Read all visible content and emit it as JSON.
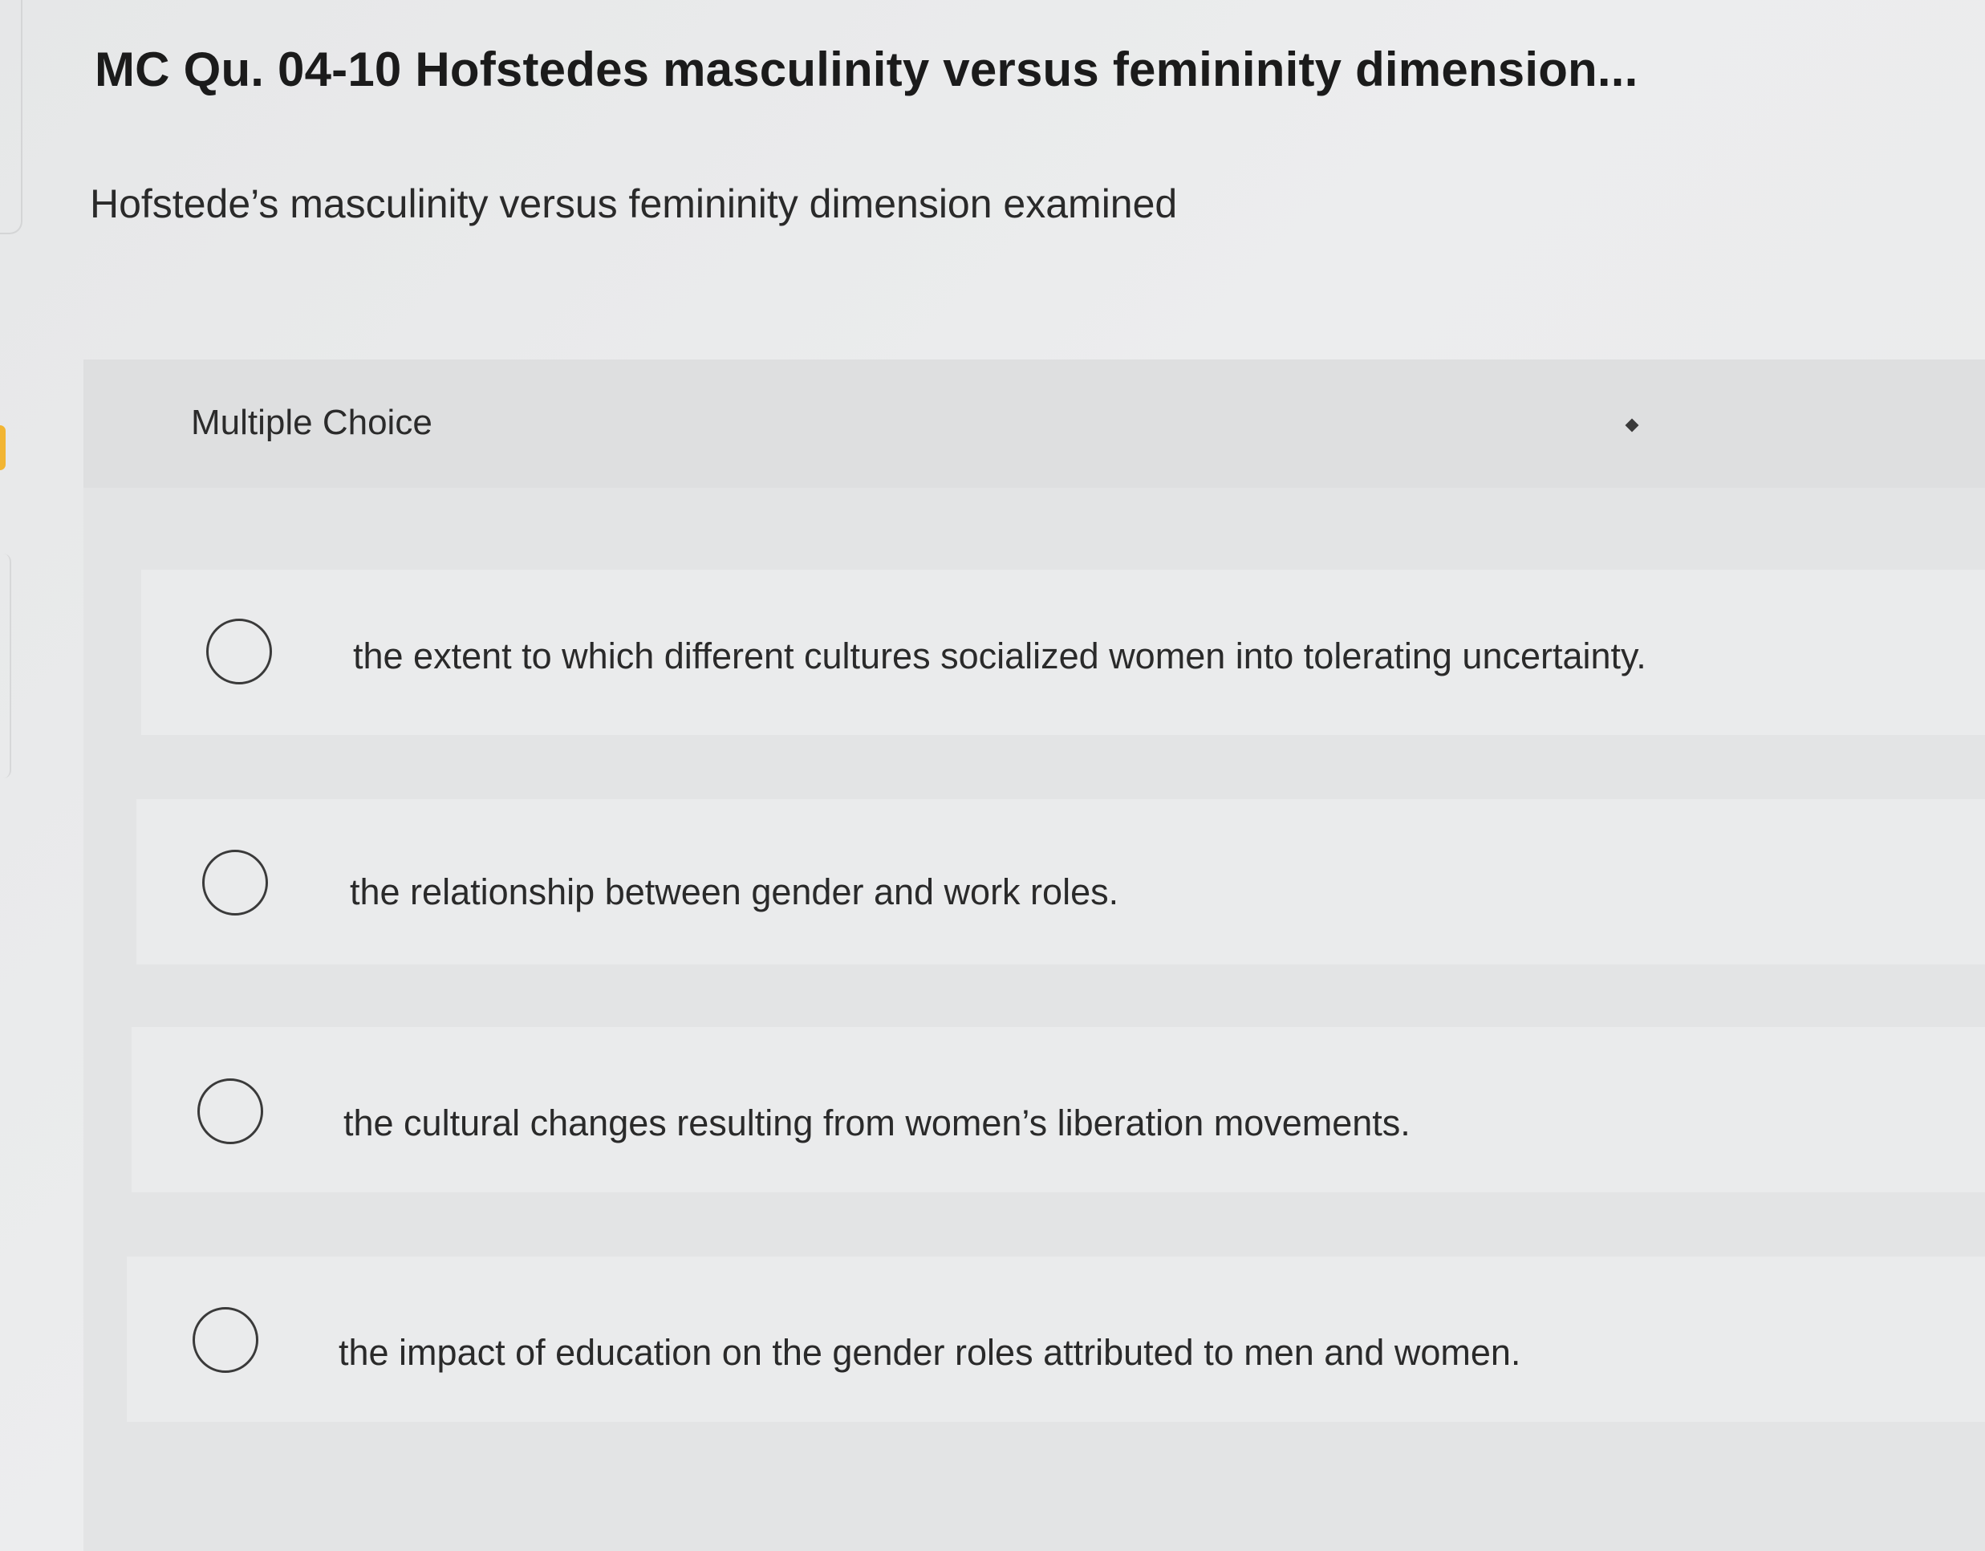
{
  "page": {
    "title": "MC Qu. 04-10 Hofstedes masculinity versus femininity dimension...",
    "question": "Hofstede’s masculinity versus femininity dimension examined"
  },
  "panel": {
    "type_label": "Multiple Choice"
  },
  "options": [
    {
      "label": "the extent to which different cultures socialized women into tolerating uncertainty.",
      "selected": false
    },
    {
      "label": "the relationship between gender and work roles.",
      "selected": false
    },
    {
      "label": "the cultural changes resulting from women’s liberation movements.",
      "selected": false
    },
    {
      "label": "the impact of education on the gender roles attributed to men and women.",
      "selected": false
    }
  ],
  "colors": {
    "background": "#e9eaea",
    "panel": "#e3e4e5",
    "option_row": "#eaebec",
    "text": "#222222",
    "accent": "#f2b533"
  }
}
